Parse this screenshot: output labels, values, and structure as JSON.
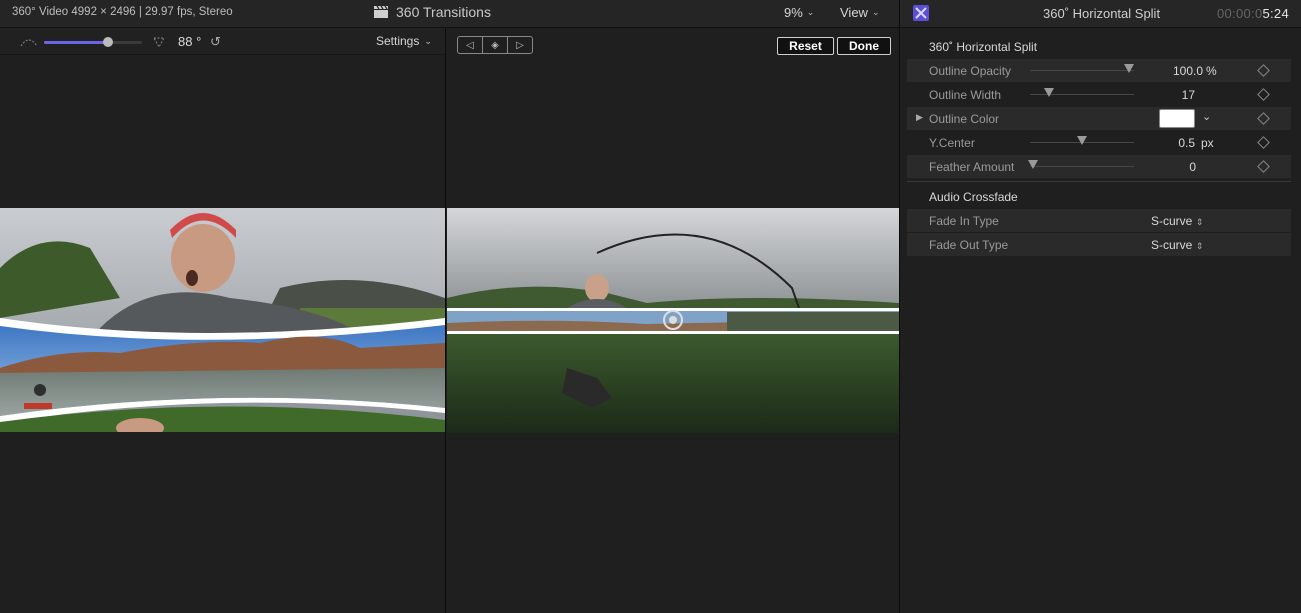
{
  "header": {
    "clip_info": "360° Video 4992 × 2496 | 29.97 fps, Stereo",
    "title": "360 Transitions",
    "zoom": "9%",
    "view_label": "View"
  },
  "left_viewer": {
    "fov_value": "88 °",
    "settings_label": "Settings"
  },
  "right_viewer": {
    "reset_label": "Reset",
    "done_label": "Done"
  },
  "inspector": {
    "title": "360˚ Horizontal Split",
    "timecode_dim": "00:00:0",
    "timecode_bright": "5:24",
    "section1_title": "360˚ Horizontal Split",
    "params": [
      {
        "label": "Outline Opacity",
        "value": "100.0",
        "unit": "%",
        "level": 0.95
      },
      {
        "label": "Outline Width",
        "value": "17",
        "unit": "",
        "level": 0.17
      },
      {
        "label": "Outline Color",
        "value": "",
        "unit": "",
        "color": "#ffffff"
      },
      {
        "label": "Y.Center",
        "value": "0.5",
        "unit": "px",
        "level": 0.5
      },
      {
        "label": "Feather Amount",
        "value": "0",
        "unit": "",
        "level": 0.0
      }
    ],
    "section2_title": "Audio Crossfade",
    "fade_in": {
      "label": "Fade In Type",
      "value": "S-curve"
    },
    "fade_out": {
      "label": "Fade Out Type",
      "value": "S-curve"
    }
  },
  "colors": {
    "accent": "#6c63e8",
    "background": "#1f1f1f"
  }
}
